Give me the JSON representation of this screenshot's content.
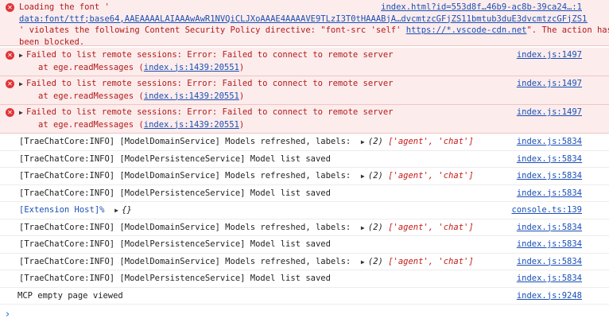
{
  "font_error": {
    "line1_prefix": "Loading the font '",
    "source": "index.html?id=553d8f…46b9-ac8b-39ca24…:1",
    "data_uri": "data:font/ttf;base64,AAEAAAALAIAAAwAwR1NVQiCLJXoAAAE4AAAAVE9TLzI3T0tHAAABjA…dvcmtzcGFjZS11bmtub3duE3dvcmtzcGFjZS11bn…",
    "line2_prefix": "' violates the following Content Security Policy directive: \"font-src 'self' ",
    "csp_link": "https://*.vscode-cdn.net",
    "line2_suffix": "\". The action has",
    "line3": "been blocked."
  },
  "remote_errors": [
    {
      "message": "Failed to list remote sessions: Error: Failed to connect to remote server",
      "at_prefix": "at ege.readMessages (",
      "at_link": "index.js:1439:20551",
      "at_suffix": ")",
      "source": "index.js:1497"
    },
    {
      "message": "Failed to list remote sessions: Error: Failed to connect to remote server",
      "at_prefix": "at ege.readMessages (",
      "at_link": "index.js:1439:20551",
      "at_suffix": ")",
      "source": "index.js:1497"
    },
    {
      "message": "Failed to list remote sessions: Error: Failed to connect to remote server",
      "at_prefix": "at ege.readMessages (",
      "at_link": "index.js:1439:20551",
      "at_suffix": ")",
      "source": "index.js:1497"
    }
  ],
  "logs": [
    {
      "text": "[TraeChatCore:INFO] [ModelDomainService] Models refreshed, labels:",
      "count": "(2)",
      "arr_open": "['agent', 'chat']",
      "source": "index.js:5834"
    },
    {
      "text": "[TraeChatCore:INFO] [ModelPersistenceService] Model list saved",
      "source": "index.js:5834"
    },
    {
      "text": "[TraeChatCore:INFO] [ModelDomainService] Models refreshed, labels:",
      "count": "(2)",
      "arr_open": "['agent', 'chat']",
      "source": "index.js:5834"
    },
    {
      "text": "[TraeChatCore:INFO] [ModelPersistenceService] Model list saved",
      "source": "index.js:5834"
    }
  ],
  "extension_host": {
    "label": "[Extension Host]%",
    "obj": "{}",
    "source": "console.ts:139"
  },
  "logs2": [
    {
      "text": "[TraeChatCore:INFO] [ModelDomainService] Models refreshed, labels:",
      "count": "(2)",
      "arr_open": "['agent', 'chat']",
      "source": "index.js:5834"
    },
    {
      "text": "[TraeChatCore:INFO] [ModelPersistenceService] Model list saved",
      "source": "index.js:5834"
    },
    {
      "text": "[TraeChatCore:INFO] [ModelDomainService] Models refreshed, labels:",
      "count": "(2)",
      "arr_open": "['agent', 'chat']",
      "source": "index.js:5834"
    },
    {
      "text": "[TraeChatCore:INFO] [ModelPersistenceService] Model list saved",
      "source": "index.js:5834"
    }
  ],
  "mcp": {
    "text": "MCP empty page viewed",
    "source": "index.js:9248"
  },
  "prompt_symbol": "›"
}
